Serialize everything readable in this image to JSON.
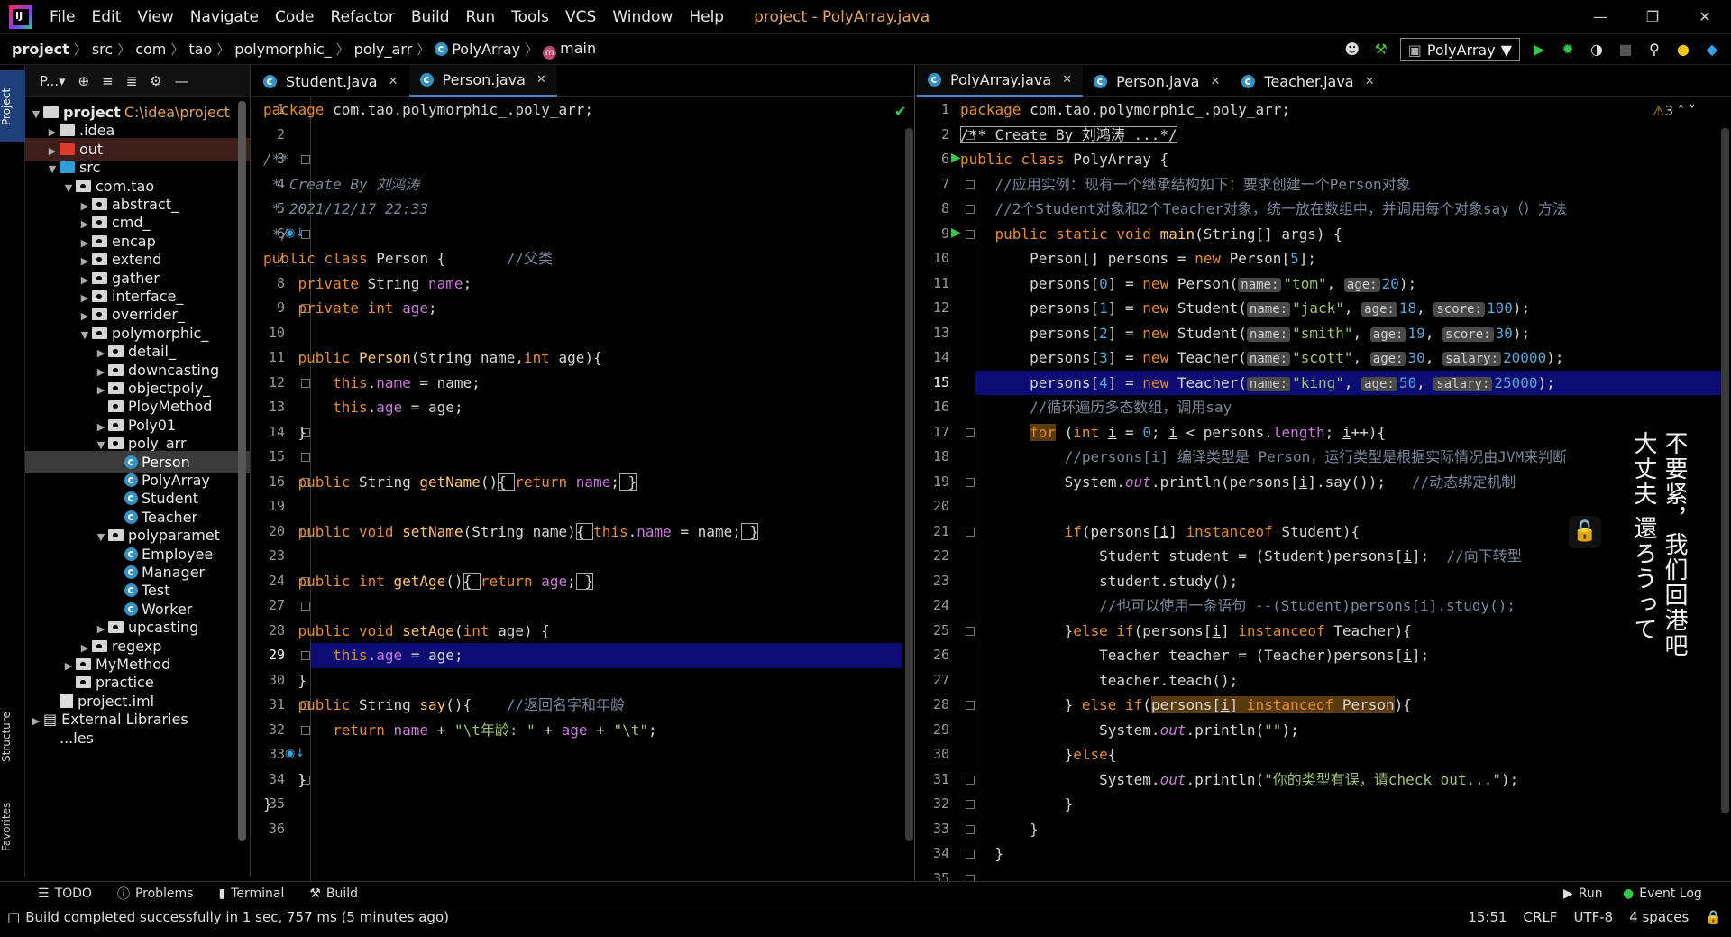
{
  "menubar": {
    "items": [
      "File",
      "Edit",
      "View",
      "Navigate",
      "Code",
      "Refactor",
      "Build",
      "Run",
      "Tools",
      "VCS",
      "Window",
      "Help"
    ],
    "title": "project - PolyArray.java"
  },
  "breadcrumb": [
    "project",
    "src",
    "com",
    "tao",
    "polymorphic_",
    "poly_arr",
    "PolyArray",
    "main"
  ],
  "run_config": "PolyArray",
  "project_panel": {
    "label": "P...",
    "nodes": [
      {
        "name": "project",
        "path": "C:\\idea\\project",
        "indent": 0,
        "open": true,
        "kind": "root"
      },
      {
        "name": ".idea",
        "indent": 1,
        "kind": "folder"
      },
      {
        "name": "out",
        "indent": 1,
        "kind": "red"
      },
      {
        "name": "src",
        "indent": 1,
        "open": true,
        "kind": "blue"
      },
      {
        "name": "com.tao",
        "indent": 2,
        "open": true,
        "kind": "pkg"
      },
      {
        "name": "abstract_",
        "indent": 3,
        "kind": "pkg"
      },
      {
        "name": "cmd_",
        "indent": 3,
        "kind": "pkg"
      },
      {
        "name": "encap",
        "indent": 3,
        "kind": "pkg"
      },
      {
        "name": "extend",
        "indent": 3,
        "kind": "pkg"
      },
      {
        "name": "gather",
        "indent": 3,
        "kind": "pkg"
      },
      {
        "name": "interface_",
        "indent": 3,
        "kind": "pkg"
      },
      {
        "name": "overrider_",
        "indent": 3,
        "kind": "pkg"
      },
      {
        "name": "polymorphic_",
        "indent": 3,
        "open": true,
        "kind": "pkg"
      },
      {
        "name": "detail_",
        "indent": 4,
        "kind": "pkg"
      },
      {
        "name": "downcasting",
        "indent": 4,
        "kind": "pkg"
      },
      {
        "name": "objectpoly_",
        "indent": 4,
        "kind": "pkg"
      },
      {
        "name": "PloyMethod",
        "indent": 4,
        "kind": "pkg-leaf"
      },
      {
        "name": "Poly01",
        "indent": 4,
        "kind": "pkg"
      },
      {
        "name": "poly_arr",
        "indent": 4,
        "open": true,
        "kind": "pkg"
      },
      {
        "name": "Person",
        "indent": 5,
        "kind": "class",
        "selected": true
      },
      {
        "name": "PolyArray",
        "indent": 5,
        "kind": "class"
      },
      {
        "name": "Student",
        "indent": 5,
        "kind": "class"
      },
      {
        "name": "Teacher",
        "indent": 5,
        "kind": "class"
      },
      {
        "name": "polyparamet",
        "indent": 4,
        "open": true,
        "kind": "pkg"
      },
      {
        "name": "Employee",
        "indent": 5,
        "kind": "class"
      },
      {
        "name": "Manager",
        "indent": 5,
        "kind": "class"
      },
      {
        "name": "Test",
        "indent": 5,
        "kind": "class"
      },
      {
        "name": "Worker",
        "indent": 5,
        "kind": "class"
      },
      {
        "name": "upcasting",
        "indent": 4,
        "kind": "pkg"
      },
      {
        "name": "regexp",
        "indent": 3,
        "kind": "pkg"
      },
      {
        "name": "MyMethod",
        "indent": 2,
        "kind": "pkg"
      },
      {
        "name": "practice",
        "indent": 2,
        "kind": "pkg-leaf"
      },
      {
        "name": "project.iml",
        "indent": 1,
        "kind": "file"
      },
      {
        "name": "External Libraries",
        "indent": 0,
        "kind": "lib"
      },
      {
        "name": "...les",
        "indent": 1,
        "kind": "none"
      }
    ]
  },
  "side_tabs": {
    "project": "Project",
    "structure": "Structure",
    "favorites": "Favorites"
  },
  "left_editor": {
    "tabs": [
      {
        "name": "Student.java",
        "active": false
      },
      {
        "name": "Person.java",
        "active": true
      }
    ],
    "line_numbers": [
      "1",
      "2",
      "3",
      "4",
      "5",
      "6",
      "7",
      "8",
      "9",
      "10",
      "11",
      "12",
      "13",
      "14",
      "15",
      "16",
      "19",
      "20",
      "23",
      "24",
      "27",
      "28",
      "29",
      "30",
      "31",
      "32",
      "33",
      "34",
      "35",
      "36"
    ],
    "current_line": "29"
  },
  "right_editor": {
    "tabs": [
      {
        "name": "PolyArray.java",
        "active": true
      },
      {
        "name": "Person.java",
        "active": false
      },
      {
        "name": "Teacher.java",
        "active": false
      }
    ],
    "line_numbers": [
      "1",
      "2",
      "6",
      "7",
      "8",
      "9",
      "10",
      "11",
      "12",
      "13",
      "14",
      "15",
      "16",
      "17",
      "18",
      "19",
      "20",
      "21",
      "22",
      "23",
      "24",
      "25",
      "26",
      "27",
      "28",
      "29",
      "30",
      "31",
      "32",
      "33",
      "34",
      "35"
    ],
    "current_line": "15",
    "warnings": "3"
  },
  "overlay": {
    "line1": "不要紧，我们回港吧",
    "line2": "大丈夫 還ろうって"
  },
  "bottom_tabs": [
    "TODO",
    "Problems",
    "Terminal",
    "Build"
  ],
  "bottom_right": [
    "Run",
    "Event Log"
  ],
  "status": {
    "message": "Build completed successfully in 1 sec, 757 ms (5 minutes ago)",
    "position": "15:51",
    "line_sep": "CRLF",
    "encoding": "UTF-8",
    "indent": "4 spaces"
  },
  "colors": {
    "accent": "#4a88c7",
    "keyword": "#e58c2a",
    "string": "#9ec56c",
    "current_line": "#0c0c72"
  }
}
